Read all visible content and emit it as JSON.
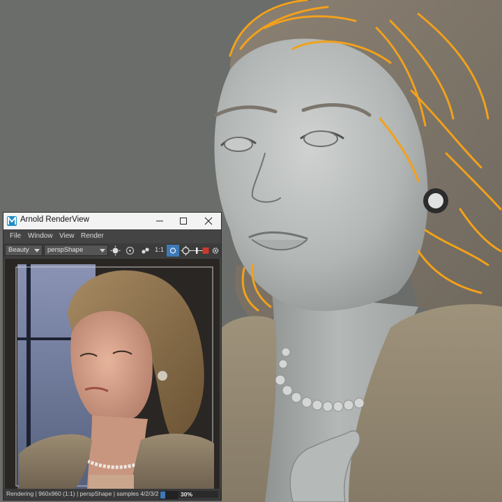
{
  "window": {
    "title": "Arnold RenderView",
    "controls": [
      "minimize-icon",
      "maximize-icon",
      "close-icon"
    ]
  },
  "menubar": {
    "items": [
      "File",
      "Window",
      "View",
      "Render"
    ]
  },
  "toolbar": {
    "aov_value": "Beauty",
    "camera_value": "perspShape",
    "ratio_label": "1:1",
    "icons": [
      "exposure-icon",
      "color-icon",
      "snapshot-icon",
      "crop-region-icon",
      "gear-icon"
    ]
  },
  "status": {
    "text": "Rendering | 960x960 (1:1) | perspShape  | samples 4/2/3/2",
    "progress": 0.3,
    "progress_label": "30%"
  },
  "colors": {
    "viewport_background": "#6b6d6b",
    "hair_guides": "#f2a11b",
    "accent_blue": "#3e79b5",
    "app_icon": "#1f8fc4"
  }
}
